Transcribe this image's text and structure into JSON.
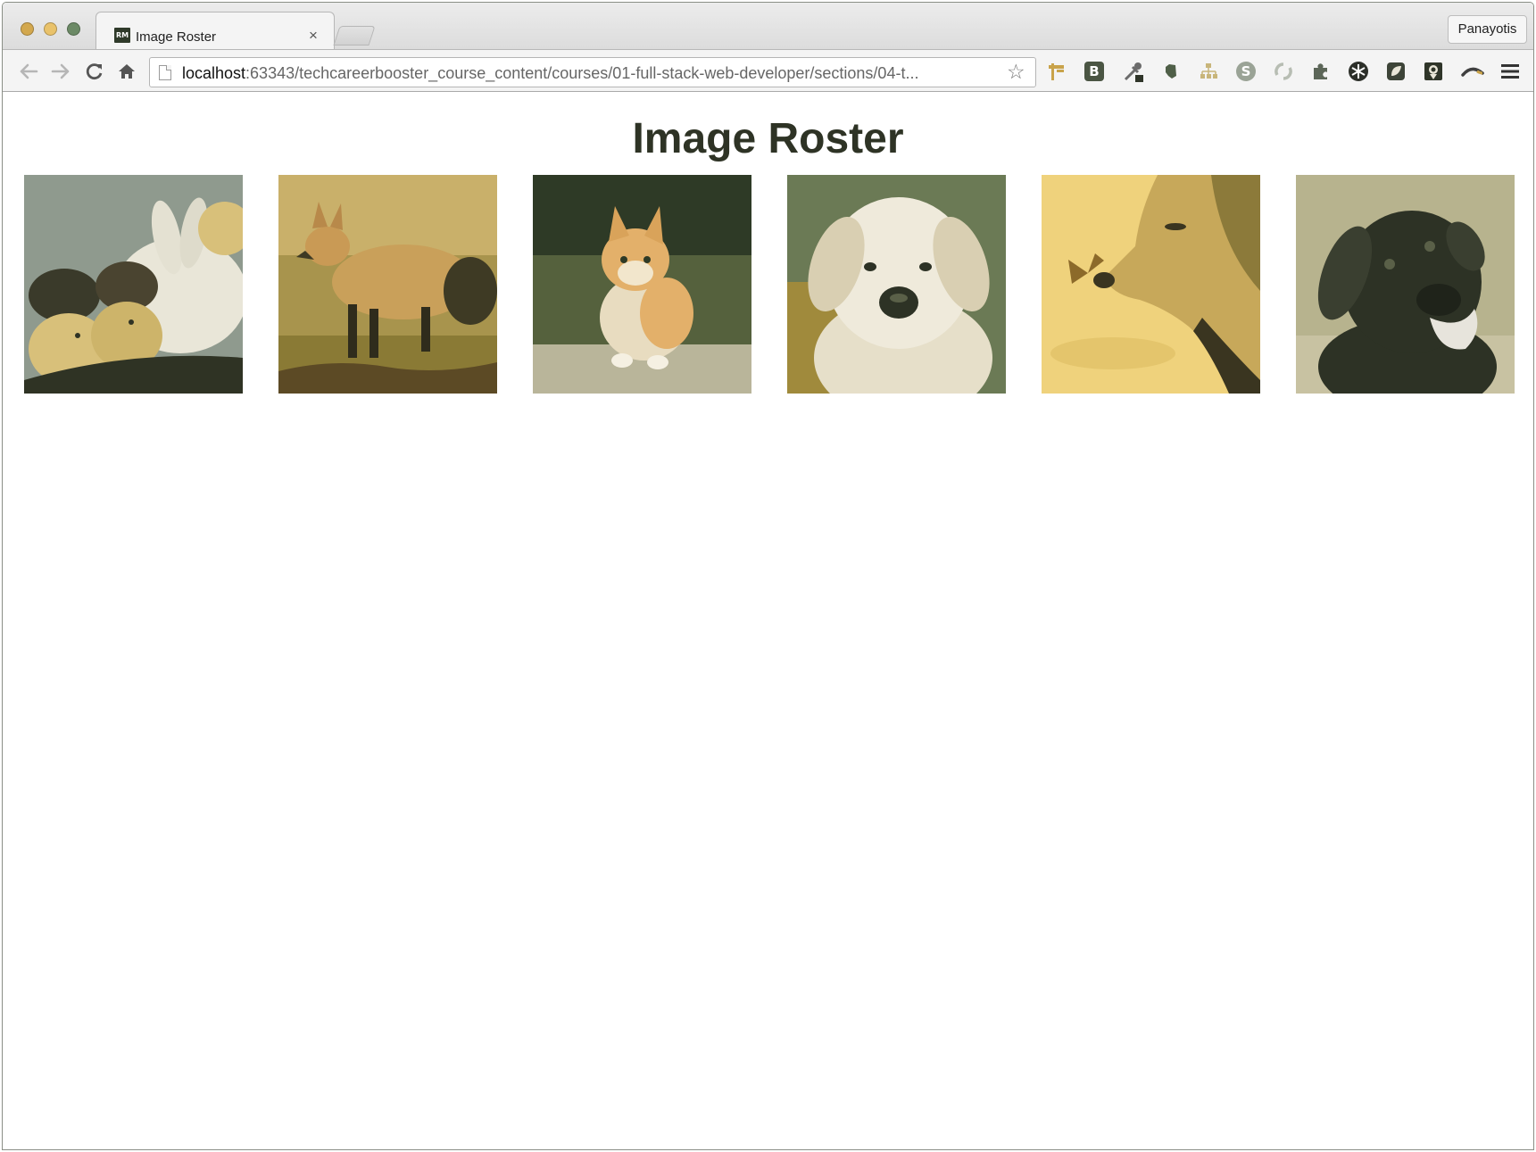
{
  "window": {
    "tab_title": "Image Roster",
    "tab_favicon_text": "RM",
    "tab_close": "×",
    "profile_name": "Panayotis"
  },
  "toolbar": {
    "back_icon": "back-arrow-icon",
    "forward_icon": "forward-arrow-icon",
    "reload_icon": "reload-icon",
    "home_icon": "home-icon",
    "url_host": "localhost",
    "url_rest": ":63343/techcareerbooster_course_content/courses/01-full-stack-web-developer/sections/04-t...",
    "bookmark_icon": "star-icon",
    "extensions": [
      {
        "name": "signpost-icon",
        "color": "#c9a34a"
      },
      {
        "name": "b-extension-icon",
        "label": "B",
        "color": "#4a5543"
      },
      {
        "name": "eyedropper-icon",
        "color": "#6b6b6b"
      },
      {
        "name": "evernote-icon",
        "color": "#4f5f48"
      },
      {
        "name": "sitemap-icon",
        "color": "#c8b57a"
      },
      {
        "name": "skype-icon",
        "label": "S",
        "color": "#9aa396"
      },
      {
        "name": "swirl-icon",
        "color": "#b7bdb3"
      },
      {
        "name": "puzzle-icon",
        "color": "#5c6658"
      },
      {
        "name": "snowflake-icon",
        "color": "#2c2f29"
      },
      {
        "name": "square-extension-icon",
        "color": "#3d4438"
      },
      {
        "name": "badge-extension-icon",
        "color": "#2f3529"
      },
      {
        "name": "boomerang-icon",
        "color": "#3f3f3f"
      }
    ],
    "menu_icon": "hamburger-menu-icon"
  },
  "page": {
    "title": "Image Roster",
    "images": [
      {
        "name": "chicks-and-bunny-photo",
        "colors": [
          "#8f9a8e",
          "#2f3324",
          "#e9e6d8",
          "#d8c07a"
        ]
      },
      {
        "name": "fox-photo",
        "colors": [
          "#a8944d",
          "#5c4a25",
          "#c9a05a",
          "#3e3a24"
        ]
      },
      {
        "name": "kitten-photo",
        "colors": [
          "#2e3a26",
          "#c7c09a",
          "#e3b06a",
          "#b9b59a"
        ]
      },
      {
        "name": "puppy-photo",
        "colors": [
          "#6b7a55",
          "#efeadb",
          "#d9cfb2",
          "#a08a3c"
        ]
      },
      {
        "name": "golden-retriever-butterfly-photo",
        "colors": [
          "#efd27c",
          "#8c7a3a",
          "#c7a85a",
          "#3a3520"
        ]
      },
      {
        "name": "black-labrador-photo",
        "colors": [
          "#b7b38e",
          "#2d3225",
          "#e7e4dc",
          "#5a6048"
        ]
      }
    ]
  }
}
